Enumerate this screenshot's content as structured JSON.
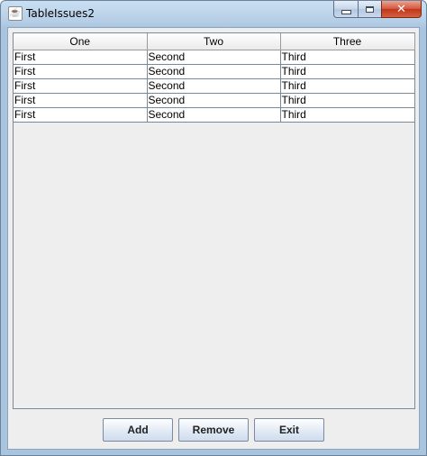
{
  "window": {
    "title": "TableIssues2",
    "app_icon_glyph": "☕",
    "controls": {
      "minimize_icon": "minimize-icon",
      "maximize_icon": "maximize-icon",
      "close_glyph": "✕"
    }
  },
  "table": {
    "columns": [
      "One",
      "Two",
      "Three"
    ],
    "rows": [
      [
        "First",
        "Second",
        "Third"
      ],
      [
        "First",
        "Second",
        "Third"
      ],
      [
        "First",
        "Second",
        "Third"
      ],
      [
        "First",
        "Second",
        "Third"
      ],
      [
        "First",
        "Second",
        "Third"
      ]
    ]
  },
  "buttons": {
    "add": "Add",
    "remove": "Remove",
    "exit": "Exit"
  },
  "colors": {
    "close_button": "#c0361b",
    "titlebar": "#b6cfe7"
  }
}
